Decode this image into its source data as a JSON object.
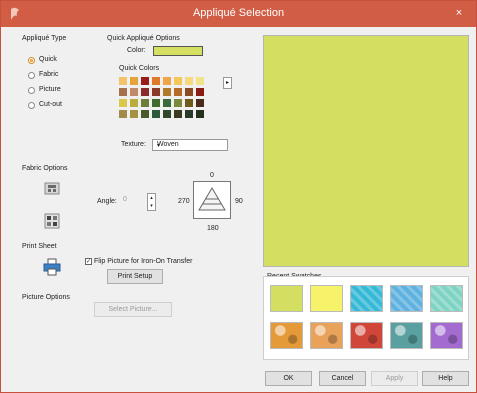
{
  "window": {
    "title": "Appliqué Selection",
    "close_label": "×"
  },
  "applique_type": {
    "heading": "Appliqué Type",
    "options": [
      {
        "label": "Quick",
        "selected": true
      },
      {
        "label": "Fabric",
        "selected": false
      },
      {
        "label": "Picture",
        "selected": false
      },
      {
        "label": "Cut-out",
        "selected": false
      }
    ]
  },
  "quick_options": {
    "heading": "Quick Appliqué Options",
    "color_label": "Color:",
    "color_value": "#d5e063",
    "quick_colors_label": "Quick Colors",
    "quick_colors": [
      "#f2c36a",
      "#e7a23c",
      "#9b1c1c",
      "#e07a2a",
      "#f0a347",
      "#f4c75a",
      "#f6d97a",
      "#f3e28a",
      "#a5714d",
      "#c18a6a",
      "#8a2a2a",
      "#8b3a2a",
      "#b07a2a",
      "#b56a2a",
      "#8a4a22",
      "#8a1a14",
      "#d9c84c",
      "#b9ad3c",
      "#6b7f3a",
      "#3f6a30",
      "#3a6a3a",
      "#7a8a3a",
      "#6f5a1c",
      "#4a2a1a",
      "#a48a4a",
      "#a39242",
      "#4a5a2a",
      "#2a5a3a",
      "#2f4a2a",
      "#3a3a22",
      "#2a3a2a",
      "#24321c"
    ],
    "more_colors_arrow": "▸",
    "texture_label": "Texture:",
    "texture_value": "Woven",
    "dropdown_arrow": "▾"
  },
  "fabric_options": {
    "heading": "Fabric Options"
  },
  "angle": {
    "label": "Angle:",
    "value": "0",
    "spin_up": "▴",
    "spin_down": "▾",
    "dial_top": "0",
    "dial_left": "270",
    "dial_right": "90",
    "dial_bottom": "180"
  },
  "print_sheet": {
    "heading": "Print Sheet",
    "flip_label": "Flip Picture for Iron-On Transfer",
    "flip_checked": true,
    "check_glyph": "✓",
    "print_setup_label": "Print Setup"
  },
  "picture_options": {
    "heading": "Picture Options",
    "select_picture_label": "Select Picture..."
  },
  "recent_swatches": {
    "heading": "Recent Swatches",
    "items": [
      {
        "name": "lime",
        "color": "#d4df62"
      },
      {
        "name": "yellow",
        "color": "#f6f36a"
      },
      {
        "name": "aqua",
        "color": "#35b9d6"
      },
      {
        "name": "sky-blue",
        "color": "#5fb2e0"
      },
      {
        "name": "mint",
        "color": "#7fd3c3"
      },
      {
        "name": "orange-floral",
        "color": "#e59a3a"
      },
      {
        "name": "peach-floral",
        "color": "#e8a25a"
      },
      {
        "name": "red-floral",
        "color": "#d0473a"
      },
      {
        "name": "teal-floral",
        "color": "#5aa0a0"
      },
      {
        "name": "purple-floral",
        "color": "#a36ad0"
      }
    ]
  },
  "footer": {
    "ok": "OK",
    "cancel": "Cancel",
    "apply": "Apply",
    "help": "Help"
  },
  "colors": {
    "titlebar": "#d25d45",
    "preview": "#d4df62",
    "accent": "#f2a23a"
  }
}
